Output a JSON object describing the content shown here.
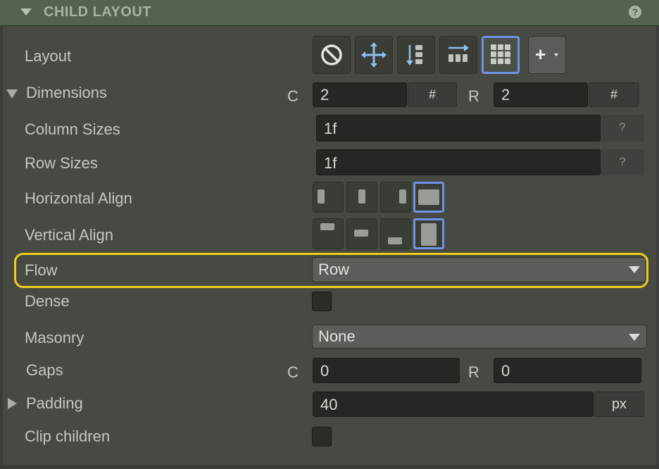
{
  "section": {
    "title": "CHILD LAYOUT",
    "help_icon": "?"
  },
  "layout": {
    "label": "Layout",
    "buttons": [
      {
        "icon": "none-icon"
      },
      {
        "icon": "move-icon"
      },
      {
        "icon": "stack-vertical-icon"
      },
      {
        "icon": "stack-horizontal-icon"
      },
      {
        "icon": "grid-icon",
        "active": true
      },
      {
        "icon": "add-icon",
        "label": "+"
      }
    ]
  },
  "dimensions": {
    "label": "Dimensions",
    "c_label": "C",
    "c_value": "2",
    "c_unit": "#",
    "r_label": "R",
    "r_value": "2",
    "r_unit": "#"
  },
  "column_sizes": {
    "label": "Column Sizes",
    "value": "1f",
    "help": "?"
  },
  "row_sizes": {
    "label": "Row Sizes",
    "value": "1f",
    "help": "?"
  },
  "horizontal_align": {
    "label": "Horizontal Align",
    "selected": "stretch"
  },
  "vertical_align": {
    "label": "Vertical Align",
    "selected": "stretch"
  },
  "flow": {
    "label": "Flow",
    "value": "Row"
  },
  "dense": {
    "label": "Dense",
    "checked": false
  },
  "masonry": {
    "label": "Masonry",
    "value": "None"
  },
  "gaps": {
    "label": "Gaps",
    "c_label": "C",
    "c_value": "0",
    "r_label": "R",
    "r_value": "0"
  },
  "padding": {
    "label": "Padding",
    "value": "40",
    "unit": "px"
  },
  "clip_children": {
    "label": "Clip children",
    "checked": false
  },
  "colors": {
    "accent": "#6c93e5",
    "highlight": "#f2cd1c",
    "header_bg": "#53634f",
    "panel_bg": "#474a43"
  }
}
